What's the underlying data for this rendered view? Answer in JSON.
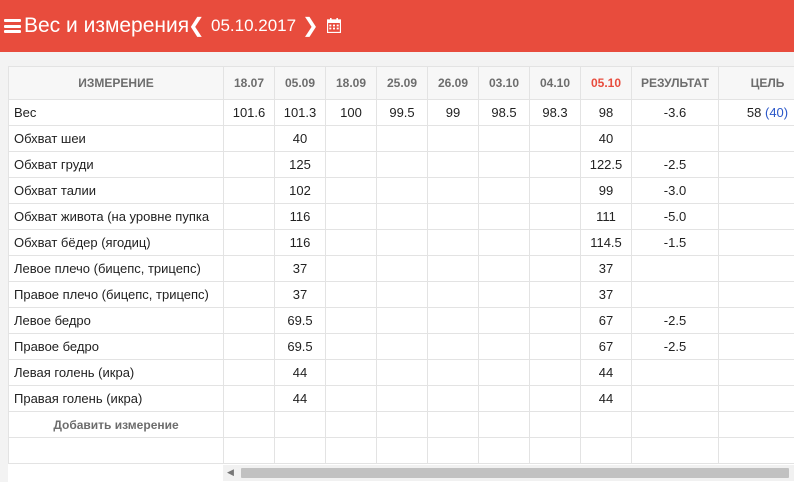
{
  "header": {
    "title": "Вес и измерения",
    "date": "05.10.2017",
    "prev_icon": "chevron-left",
    "next_icon": "chevron-right",
    "calendar_icon": "calendar",
    "menu_icon": "hamburger"
  },
  "colors": {
    "accent": "#e84c3d",
    "goal_link": "#2a57c9"
  },
  "table": {
    "columns": [
      "ИЗМЕРЕНИЕ",
      "18.07",
      "05.09",
      "18.09",
      "25.09",
      "26.09",
      "03.10",
      "04.10",
      "05.10",
      "РЕЗУЛЬТАТ",
      "ЦЕЛЬ"
    ],
    "highlight_column": "05.10",
    "rows": [
      {
        "name": "Вес",
        "values": [
          "101.6",
          "101.3",
          "100",
          "99.5",
          "99",
          "98.5",
          "98.3",
          "98"
        ],
        "result": "-3.6",
        "goal": "58",
        "goal_paren": "(40)"
      },
      {
        "name": "Обхват шеи",
        "values": [
          "",
          "40",
          "",
          "",
          "",
          "",
          "",
          "40"
        ],
        "result": "",
        "goal": "",
        "goal_paren": ""
      },
      {
        "name": "Обхват груди",
        "values": [
          "",
          "125",
          "",
          "",
          "",
          "",
          "",
          "122.5"
        ],
        "result": "-2.5",
        "goal": "",
        "goal_paren": ""
      },
      {
        "name": "Обхват талии",
        "values": [
          "",
          "102",
          "",
          "",
          "",
          "",
          "",
          "99"
        ],
        "result": "-3.0",
        "goal": "",
        "goal_paren": ""
      },
      {
        "name": "Обхват живота (на уровне пупка",
        "values": [
          "",
          "116",
          "",
          "",
          "",
          "",
          "",
          "111"
        ],
        "result": "-5.0",
        "goal": "",
        "goal_paren": ""
      },
      {
        "name": "Обхват бёдер (ягодиц)",
        "values": [
          "",
          "116",
          "",
          "",
          "",
          "",
          "",
          "114.5"
        ],
        "result": "-1.5",
        "goal": "",
        "goal_paren": ""
      },
      {
        "name": "Левое плечо (бицепс, трицепс)",
        "values": [
          "",
          "37",
          "",
          "",
          "",
          "",
          "",
          "37"
        ],
        "result": "",
        "goal": "",
        "goal_paren": ""
      },
      {
        "name": "Правое плечо (бицепс, трицепс)",
        "values": [
          "",
          "37",
          "",
          "",
          "",
          "",
          "",
          "37"
        ],
        "result": "",
        "goal": "",
        "goal_paren": ""
      },
      {
        "name": "Левое бедро",
        "values": [
          "",
          "69.5",
          "",
          "",
          "",
          "",
          "",
          "67"
        ],
        "result": "-2.5",
        "goal": "",
        "goal_paren": ""
      },
      {
        "name": "Правое бедро",
        "values": [
          "",
          "69.5",
          "",
          "",
          "",
          "",
          "",
          "67"
        ],
        "result": "-2.5",
        "goal": "",
        "goal_paren": ""
      },
      {
        "name": "Левая голень (икра)",
        "values": [
          "",
          "44",
          "",
          "",
          "",
          "",
          "",
          "44"
        ],
        "result": "",
        "goal": "",
        "goal_paren": ""
      },
      {
        "name": "Правая голень (икра)",
        "values": [
          "",
          "44",
          "",
          "",
          "",
          "",
          "",
          "44"
        ],
        "result": "",
        "goal": "",
        "goal_paren": ""
      }
    ],
    "add_label": "Добавить измерение"
  }
}
